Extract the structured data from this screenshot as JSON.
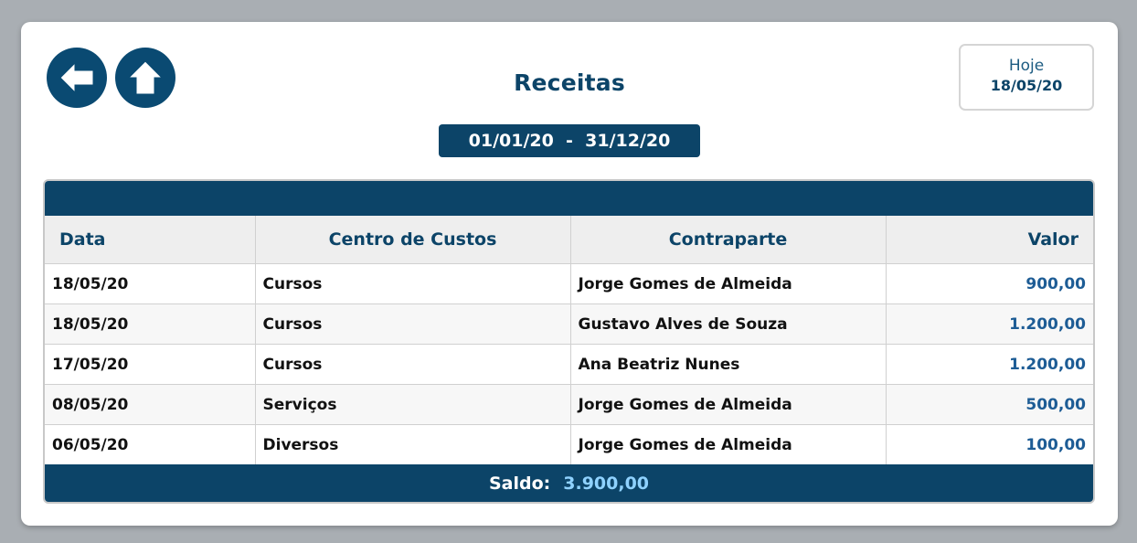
{
  "header": {
    "title": "Receitas",
    "today_label": "Hoje",
    "today_date": "18/05/20"
  },
  "period": {
    "label": "01/01/20  -  31/12/20"
  },
  "nav": {
    "back_icon": "arrow-left-icon",
    "home_icon": "arrow-up-icon"
  },
  "table": {
    "columns": [
      "Data",
      "Centro de Custos",
      "Contraparte",
      "Valor"
    ],
    "rows": [
      [
        "18/05/20",
        "Cursos",
        "Jorge Gomes de Almeida",
        "900,00"
      ],
      [
        "18/05/20",
        "Cursos",
        "Gustavo Alves de Souza",
        "1.200,00"
      ],
      [
        "17/05/20",
        "Cursos",
        "Ana Beatriz Nunes",
        "1.200,00"
      ],
      [
        "08/05/20",
        "Serviços",
        "Jorge Gomes de Almeida",
        "500,00"
      ],
      [
        "06/05/20",
        "Diversos",
        "Jorge Gomes de Almeida",
        "100,00"
      ]
    ]
  },
  "footer": {
    "saldo_label": "Saldo:",
    "saldo_value": "3.900,00"
  },
  "colors": {
    "primary": "#0c4468",
    "value_text": "#1d5c95",
    "saldo_value": "#8fd2ff"
  }
}
